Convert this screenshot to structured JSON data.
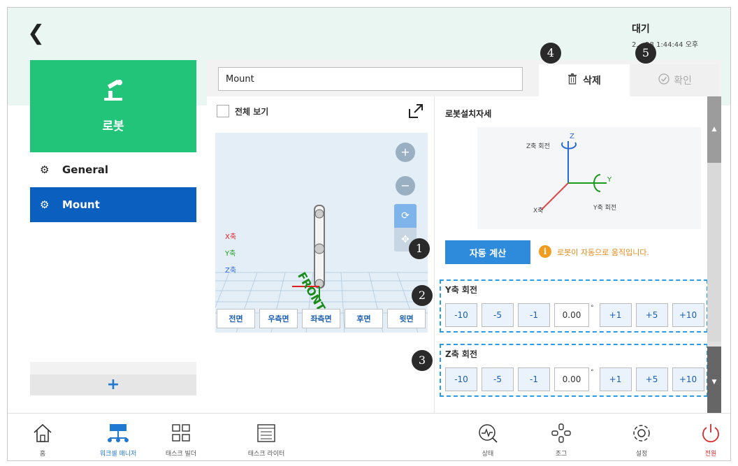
{
  "header": {
    "back_icon": "chevron-left-icon",
    "status": "대기",
    "timestamp": "2... 28 1:44:44 오후"
  },
  "markers": [
    "1",
    "2",
    "3",
    "4",
    "5"
  ],
  "sidebar": {
    "title": "로봇",
    "items": [
      {
        "label": "General"
      },
      {
        "label": "Mount"
      }
    ],
    "add_label": "+"
  },
  "toolbar": {
    "name_value": "Mount",
    "delete_label": "삭제",
    "confirm_label": "확인"
  },
  "viewer": {
    "full_view_label": "전체 보기",
    "axis_labels": [
      "X축",
      "Y축",
      "Z축"
    ],
    "front_label": "FRONT",
    "view_buttons": [
      "전면",
      "우측면",
      "좌측면",
      "후면",
      "윗면"
    ]
  },
  "mount": {
    "section_title": "로봇설치자세",
    "diagram": {
      "z_rotation_label": "Z축 회전",
      "y_rotation_label": "Y축 회전",
      "z_axis": "Z",
      "y_axis": "Y",
      "x_axis": "X축"
    },
    "auto_calc_label": "자동 계산",
    "auto_info": "로봇이 자동으로 움직입니다.",
    "y_rotation": {
      "title": "Y축 회전",
      "buttons": [
        "-10",
        "-5",
        "-1",
        "+1",
        "+5",
        "+10"
      ],
      "value": "0.00",
      "unit": "°"
    },
    "z_rotation": {
      "title": "Z축 회전",
      "buttons": [
        "-10",
        "-5",
        "-1",
        "+1",
        "+5",
        "+10"
      ],
      "value": "0.00",
      "unit": "°"
    }
  },
  "bottom_nav": [
    {
      "label": "홈"
    },
    {
      "label": "워크셀 매니저"
    },
    {
      "label": "태스크 빌더"
    },
    {
      "label": "태스크 라이터"
    },
    {
      "label": "상태"
    },
    {
      "label": "조그"
    },
    {
      "label": "설정"
    },
    {
      "label": "전원"
    }
  ],
  "colors": {
    "accent_green": "#22c47a",
    "selected_blue": "#0b5fbf",
    "button_blue": "#2e8bdc",
    "power_red": "#d62b2b",
    "warning_orange": "#f29b1e"
  }
}
